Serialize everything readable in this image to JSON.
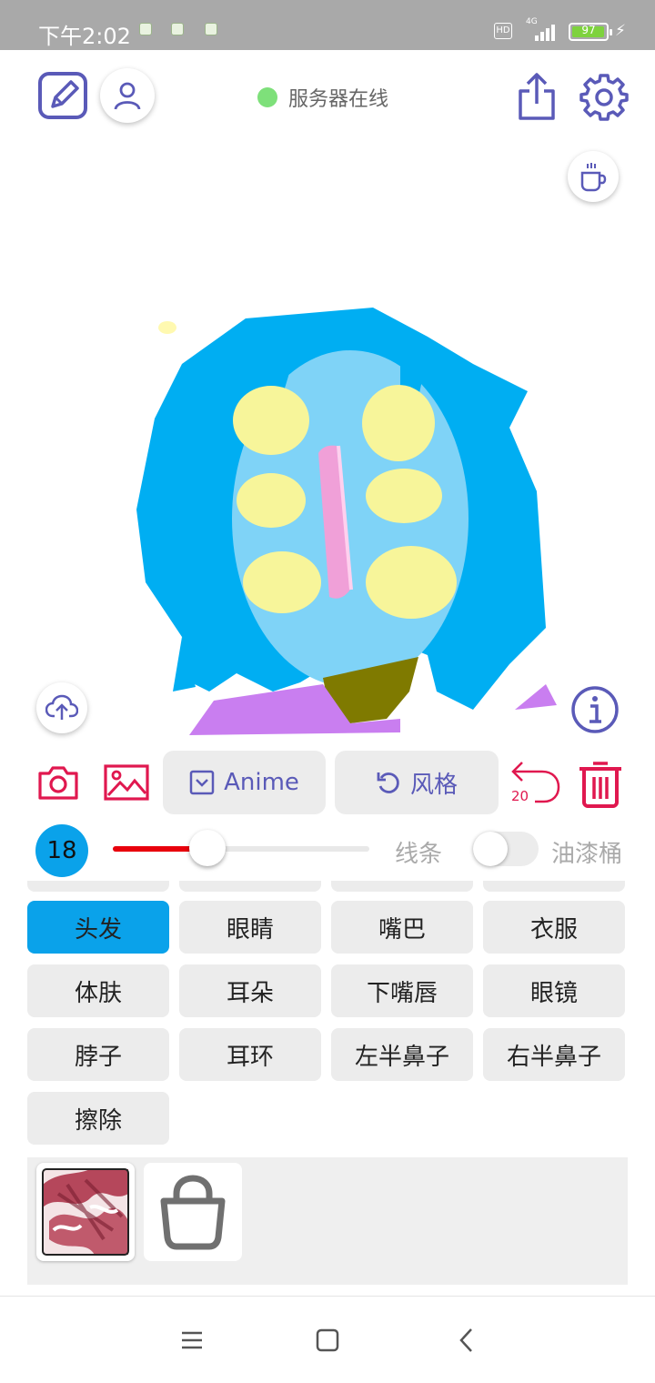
{
  "status_bar": {
    "time": "下午2:02",
    "hd": "HD",
    "network": "4G",
    "battery": "97",
    "battery_level": 0.97
  },
  "header": {
    "server_status": "服务器在线",
    "status_color": "#7ee07a",
    "accent_color": "#5a5ab8"
  },
  "tools": {
    "anime_label": "Anime",
    "style_label": "风格",
    "undo_count": "20",
    "accent_red": "#e0184f"
  },
  "brush": {
    "size": "18",
    "slider_value": 0.37,
    "lines_label": "线条",
    "bucket_label": "油漆桶",
    "bucket_enabled": false
  },
  "parts": [
    {
      "label": "头发",
      "active": true
    },
    {
      "label": "眼睛",
      "active": false
    },
    {
      "label": "嘴巴",
      "active": false
    },
    {
      "label": "衣服",
      "active": false
    },
    {
      "label": "体肤",
      "active": false
    },
    {
      "label": "耳朵",
      "active": false
    },
    {
      "label": "下嘴唇",
      "active": false
    },
    {
      "label": "眼镜",
      "active": false
    },
    {
      "label": "脖子",
      "active": false
    },
    {
      "label": "耳环",
      "active": false
    },
    {
      "label": "左半鼻子",
      "active": false
    },
    {
      "label": "右半鼻子",
      "active": false
    },
    {
      "label": "擦除",
      "active": false
    }
  ],
  "icons": {
    "edit": "edit-icon",
    "profile": "user-icon",
    "share": "share-icon",
    "settings": "gear-icon",
    "coffee": "coffee-icon",
    "upload": "cloud-upload-icon",
    "info": "info-icon",
    "camera": "camera-icon",
    "gallery": "image-icon",
    "undo": "undo-icon",
    "delete": "trash-icon",
    "shop": "shopping-bag-icon"
  }
}
